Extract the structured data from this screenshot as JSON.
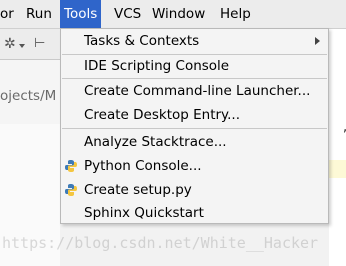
{
  "menubar": {
    "items": [
      {
        "label": "or"
      },
      {
        "label": "Run"
      },
      {
        "label": "Tools"
      },
      {
        "label": "VCS"
      },
      {
        "label": "Window"
      },
      {
        "label": "Help"
      }
    ]
  },
  "toolbar": {
    "path_text": "ojects/M"
  },
  "editor": {
    "comma": ", "
  },
  "tools_menu": {
    "items": [
      {
        "label": "Tasks & Contexts"
      },
      {
        "label": "IDE Scripting Console"
      },
      {
        "label": "Create Command-line Launcher..."
      },
      {
        "label": "Create Desktop Entry..."
      },
      {
        "label": "Analyze Stacktrace..."
      },
      {
        "label": "Python Console..."
      },
      {
        "label": "Create setup.py"
      },
      {
        "label": "Sphinx Quickstart"
      }
    ],
    "submenu_arrow": "chevron-right-icon",
    "python_icon": "python-icon",
    "highlight_color": "#2f65ca"
  },
  "watermark": "https://blog.csdn.net/White__Hacker"
}
